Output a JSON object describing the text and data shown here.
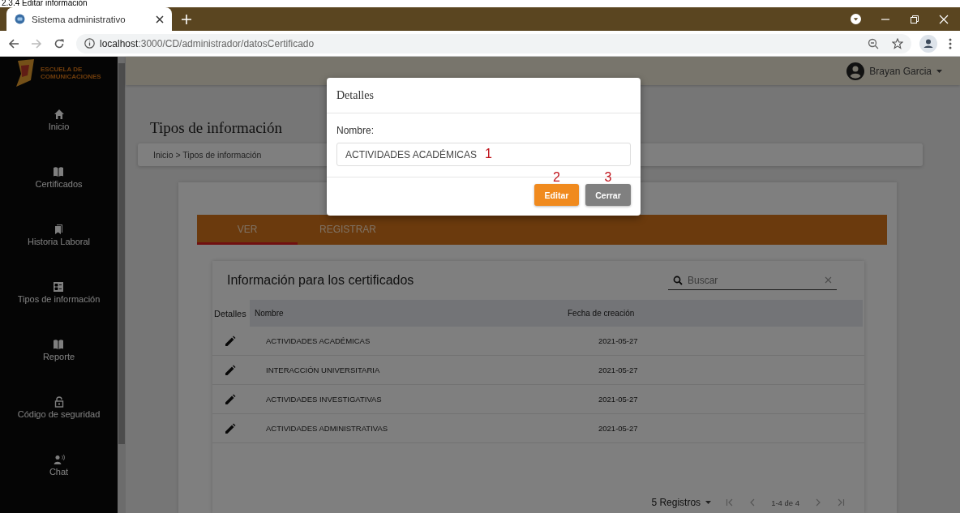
{
  "document_heading": "2.3.4 Editar información",
  "browser": {
    "tab_title": "Sistema administrativo",
    "url_host": "localhost",
    "url_path": ":3000/CD/administrador/datosCertificado"
  },
  "sidebar": {
    "logo_text": "ESCUELA DE COMUNICACIONES",
    "items": [
      {
        "label": "Inicio"
      },
      {
        "label": "Certificados"
      },
      {
        "label": "Historia Laboral"
      },
      {
        "label": "Tipos de información"
      },
      {
        "label": "Reporte"
      },
      {
        "label": "Código de seguridad"
      },
      {
        "label": "Chat"
      }
    ]
  },
  "topbar": {
    "user": "Brayan Garcia"
  },
  "page": {
    "title": "Tipos de información",
    "breadcrumb": "Inicio > Tipos de información",
    "tabs": [
      {
        "label": "VER",
        "selected": true
      },
      {
        "label": "REGISTRAR",
        "selected": false
      }
    ],
    "table": {
      "title": "Información para los certificados",
      "search_placeholder": "Buscar",
      "columns": [
        "Detalles",
        "Nombre",
        "Fecha de creación"
      ],
      "rows": [
        {
          "name": "ACTIVIDADES ACADÉMICAS",
          "date": "2021-05-27"
        },
        {
          "name": "INTERACCIÓN UNIVERSITARIA",
          "date": "2021-05-27"
        },
        {
          "name": "ACTIVIDADES INVESTIGATIVAS",
          "date": "2021-05-27"
        },
        {
          "name": "ACTIVIDADES ADMINISTRATIVAS",
          "date": "2021-05-27"
        }
      ],
      "page_size": "5 Registros",
      "range": "1-4 de 4"
    }
  },
  "modal": {
    "title": "Detalles",
    "field_label": "Nombre:",
    "field_value": "ACTIVIDADES ACADÉMICAS",
    "buttons": [
      {
        "label": "Editar",
        "kind": "primary",
        "marker": "2"
      },
      {
        "label": "Cerrar",
        "kind": "secondary",
        "marker": "3"
      }
    ],
    "field_marker": "1"
  }
}
